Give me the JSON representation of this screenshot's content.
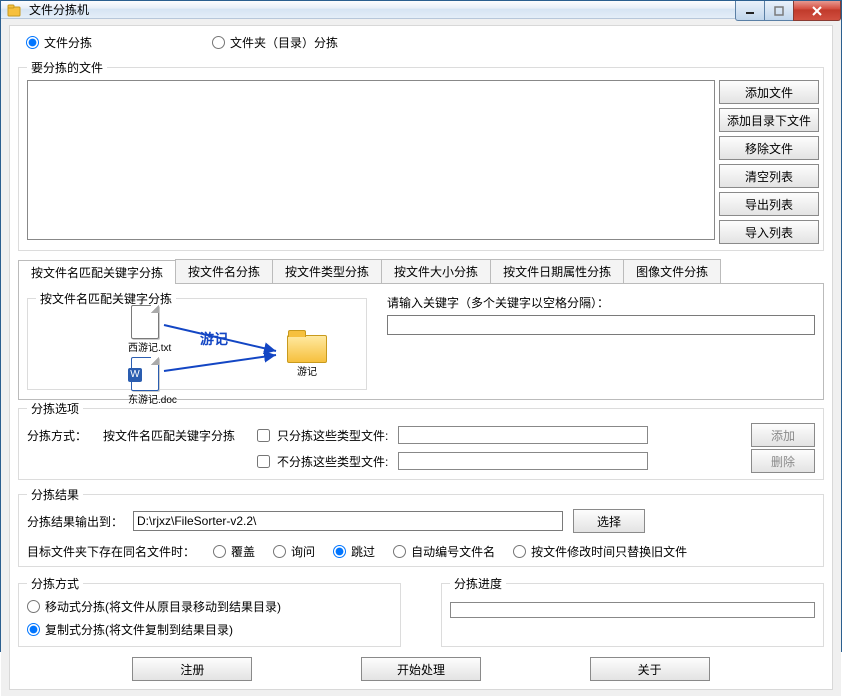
{
  "window": {
    "title": "文件分拣机"
  },
  "topRadios": {
    "fileSort": "文件分拣",
    "folderSort": "文件夹（目录）分拣",
    "selected": "fileSort"
  },
  "fileSet": {
    "legend": "要分拣的文件",
    "buttons": {
      "addFile": "添加文件",
      "addDirFiles": "添加目录下文件",
      "removeFile": "移除文件",
      "clearList": "清空列表",
      "exportList": "导出列表",
      "importList": "导入列表"
    }
  },
  "tabs": [
    "按文件名匹配关键字分拣",
    "按文件名分拣",
    "按文件类型分拣",
    "按文件大小分拣",
    "按文件日期属性分拣",
    "图像文件分拣"
  ],
  "tabActive": 0,
  "tab0": {
    "diagramTitle": "按文件名匹配关键字分拣",
    "file1": "西游记.txt",
    "file2": "东游记.doc",
    "arrowLabel": "游记",
    "folder": "游记",
    "kwHint": "请输入关键字（多个关键字以空格分隔）：",
    "kwValue": ""
  },
  "sortOptions": {
    "legend": "分拣选项",
    "methodLabel": "分拣方式：",
    "methodValue": "按文件名匹配关键字分拣",
    "onlyTypesLabel": "只分拣这些类型文件:",
    "excludeTypesLabel": "不分拣这些类型文件:",
    "onlyTypesValue": "",
    "excludeTypesValue": "",
    "addBtn": "添加",
    "delBtn": "删除"
  },
  "result": {
    "legend": "分拣结果",
    "outLabel": "分拣结果输出到：",
    "outPath": "D:\\rjxz\\FileSorter-v2.2\\",
    "chooseBtn": "选择",
    "sameNameLabel": "目标文件夹下存在同名文件时：",
    "opts": {
      "overwrite": "覆盖",
      "ask": "询问",
      "skip": "跳过",
      "autoNumber": "自动编号文件名",
      "replaceOld": "按文件修改时间只替换旧文件"
    },
    "sameSelected": "skip"
  },
  "methodBox": {
    "legend": "分拣方式",
    "move": "移动式分拣(将文件从原目录移动到结果目录)",
    "copy": "复制式分拣(将文件复制到结果目录)",
    "selected": "copy"
  },
  "progressBox": {
    "legend": "分拣进度"
  },
  "bottom": {
    "register": "注册",
    "start": "开始处理",
    "about": "关于"
  }
}
